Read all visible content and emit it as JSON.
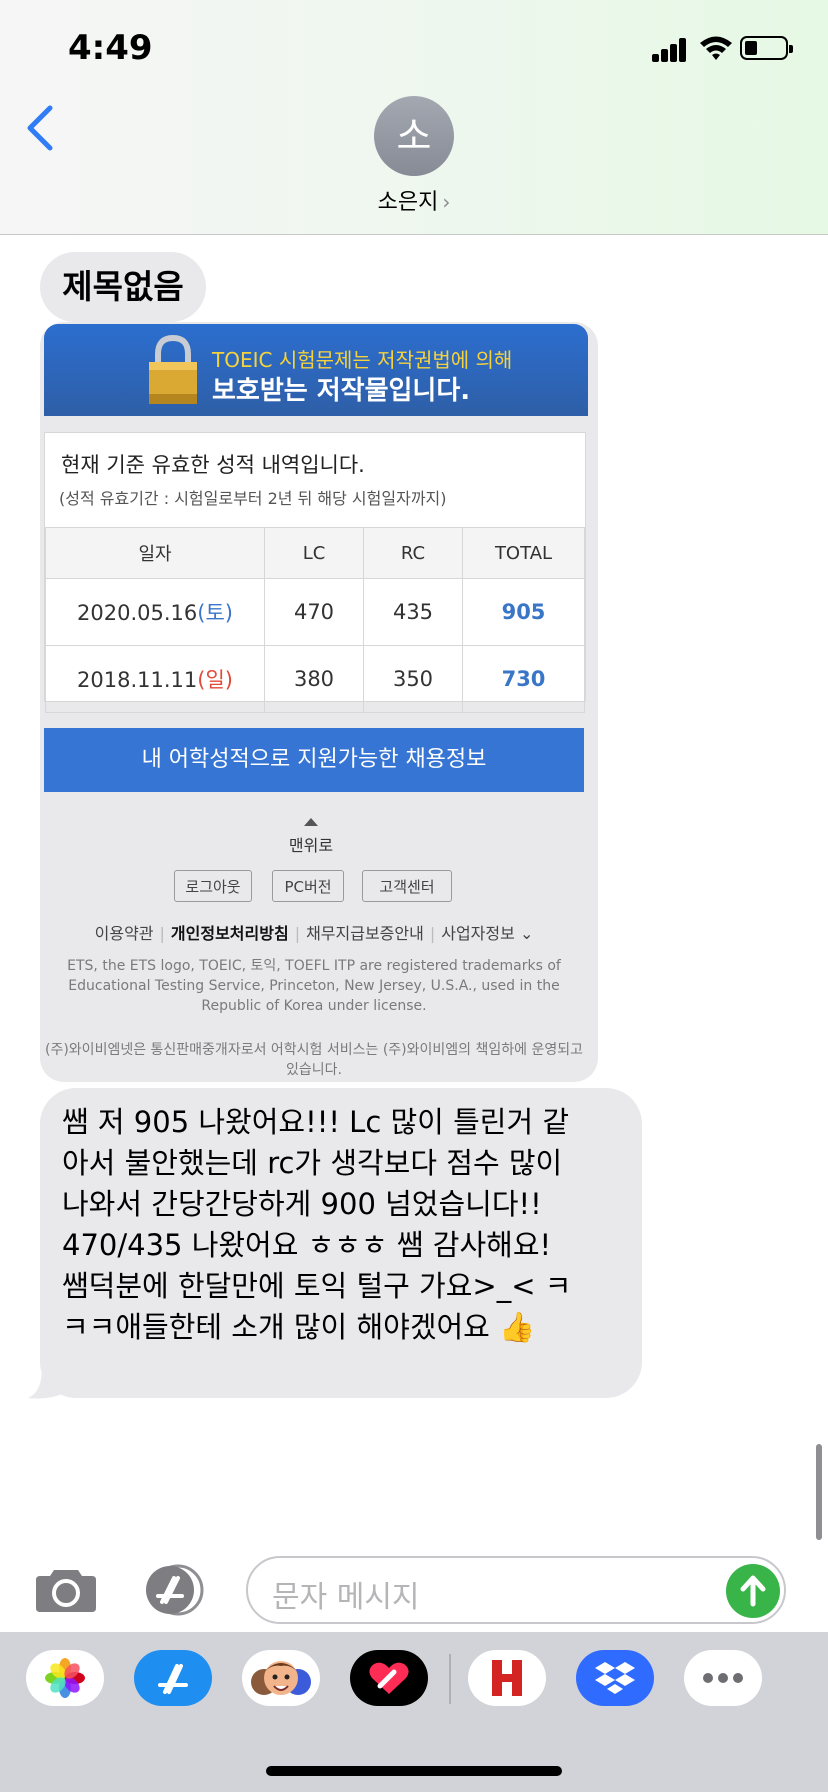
{
  "status": {
    "time": "4:49"
  },
  "contact": {
    "avatar_initial": "소",
    "name": "소은지",
    "chevron": "›"
  },
  "thread": {
    "title_bubble": "제목없음",
    "image": {
      "banner_line1": "TOEIC 시험문제는 저작권법에 의해",
      "banner_line2": "보호받는 저작물입니다.",
      "panel_line1": "현재 기준 유효한 성적 내역입니다.",
      "panel_line2": "(성적 유효기간 : 시험일로부터 2년 뒤 해당 시험일자까지)",
      "table": {
        "headers": [
          "일자",
          "LC",
          "RC",
          "TOTAL"
        ],
        "rows": [
          {
            "date": "2020.05.16",
            "day": "(토)",
            "lc": "470",
            "rc": "435",
            "total": "905"
          },
          {
            "date": "2018.11.11",
            "day": "(일)",
            "lc": "380",
            "rc": "350",
            "total": "730"
          }
        ]
      },
      "blue_button": "내 어학성적으로 지원가능한 채용정보",
      "to_top": "맨위로",
      "footer_buttons": [
        "로그아웃",
        "PC버전",
        "고객센터"
      ],
      "footer_links": [
        "이용약관",
        "개인정보처리방침",
        "채무지급보증안내",
        "사업자정보"
      ],
      "footer_links_chevron": "⌄",
      "trademark_text": "ETS, the ETS logo, TOEIC, 토익, TOEFL ITP are registered trademarks of Educational Testing Service, Princeton, New Jersey, U.S.A., used in the Republic of Korea under license.",
      "company_text": "(주)와이비엠넷은 통신판매중개자로서 어학시험 서비스는 (주)와이비엠의 책임하에 운영되고 있습니다."
    },
    "message": "쌤 저 905 나왔어요!!! Lc 많이 틀린거 같\n아서 불안했는데 rc가 생각보다 점수 많이\n나와서 간당간당하게 900 넘었습니다!!\n470/435 나왔어요 ㅎㅎㅎ 쌤 감사해요!\n쌤덕분에 한달만에 토익 털구 가요>_< ㅋ\nㅋㅋ애들한테 소개 많이 해야겠어요 👍"
  },
  "composer": {
    "placeholder": "문자 메시지"
  },
  "app_drawer": {
    "apps": [
      "photos-app",
      "app-store-app",
      "memoji-app",
      "digital-touch-app",
      "hotels-app",
      "dropbox-app",
      "more-apps"
    ]
  }
}
